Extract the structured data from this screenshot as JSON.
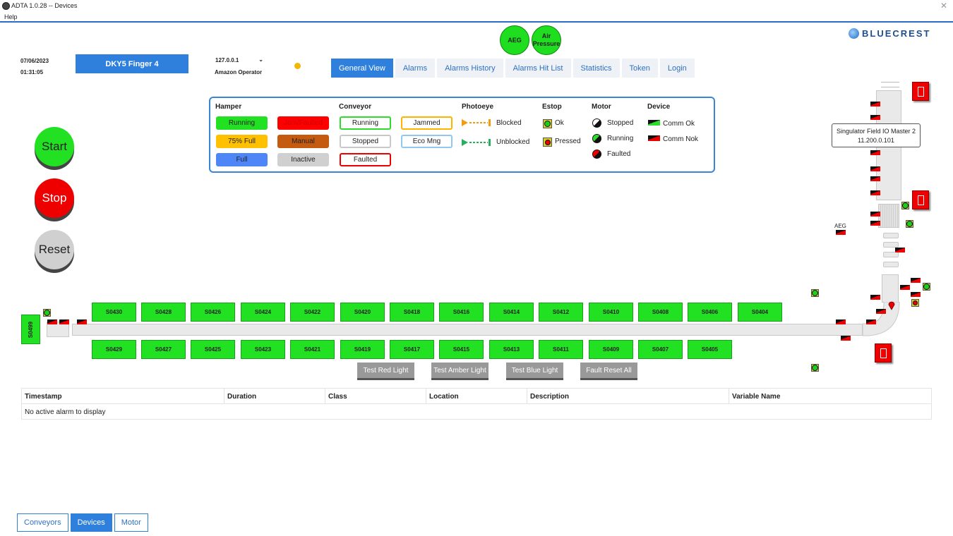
{
  "window": {
    "title": "ADTA 1.0.28 -- Devices",
    "close": "✕"
  },
  "menu": {
    "help": "Help"
  },
  "header": {
    "date": "07/06/2023",
    "time": "01:31:05",
    "machine": "DKY5 Finger 4",
    "ip": "127.0.0.1",
    "operator": "Amazon Operator",
    "aeg": "AEG",
    "air_pressure_1": "Air",
    "air_pressure_2": "Pressure",
    "logo": "BLUECREST"
  },
  "tabs": [
    "General View",
    "Alarms",
    "Alarms History",
    "Alarms Hit List",
    "Statistics",
    "Token",
    "Login"
  ],
  "legend": {
    "hamper": {
      "title": "Hamper",
      "running": "Running",
      "jam": "Jam/Faulted",
      "full75": "75% Full",
      "manual": "Manual",
      "full": "Full",
      "inactive": "Inactive"
    },
    "conveyor": {
      "title": "Conveyor",
      "running": "Running",
      "jammed": "Jammed",
      "stopped": "Stopped",
      "eco": "Eco Mng",
      "faulted": "Faulted"
    },
    "photoeye": {
      "title": "Photoeye",
      "blocked": "Blocked",
      "unblocked": "Unblocked"
    },
    "estop": {
      "title": "Estop",
      "ok": "Ok",
      "pressed": "Pressed"
    },
    "motor": {
      "title": "Motor",
      "stopped": "Stopped",
      "running": "Running",
      "faulted": "Faulted"
    },
    "device": {
      "title": "Device",
      "ok": "Comm Ok",
      "nok": "Comm Nok"
    }
  },
  "controls": {
    "start": "Start",
    "stop": "Stop",
    "reset": "Reset"
  },
  "hampers": {
    "top": [
      "S0430",
      "S0428",
      "S0426",
      "S0424",
      "S0422",
      "S0420",
      "S0418",
      "S0416",
      "S0414",
      "S0412",
      "S0410",
      "S0408",
      "S0406",
      "S0404"
    ],
    "bottom": [
      "S0429",
      "S0427",
      "S0425",
      "S0423",
      "S0421",
      "S0419",
      "S0417",
      "S0415",
      "S0413",
      "S0411",
      "S0409",
      "S0407",
      "S0405"
    ],
    "side": "S0499"
  },
  "tooltip": {
    "line1": "Singulator Field IO Master 2",
    "line2": "11.200.0.101"
  },
  "aeg_label": "AEG",
  "test_buttons": [
    "Test Red Light",
    "Test Amber Light",
    "Test Blue Light",
    "Fault Reset All"
  ],
  "alarm_table": {
    "columns": [
      "Timestamp",
      "Duration",
      "Class",
      "Location",
      "Description",
      "Variable Name"
    ],
    "empty": "No active alarm to display"
  },
  "bottom_tabs": [
    "Conveyors",
    "Devices",
    "Motor"
  ]
}
